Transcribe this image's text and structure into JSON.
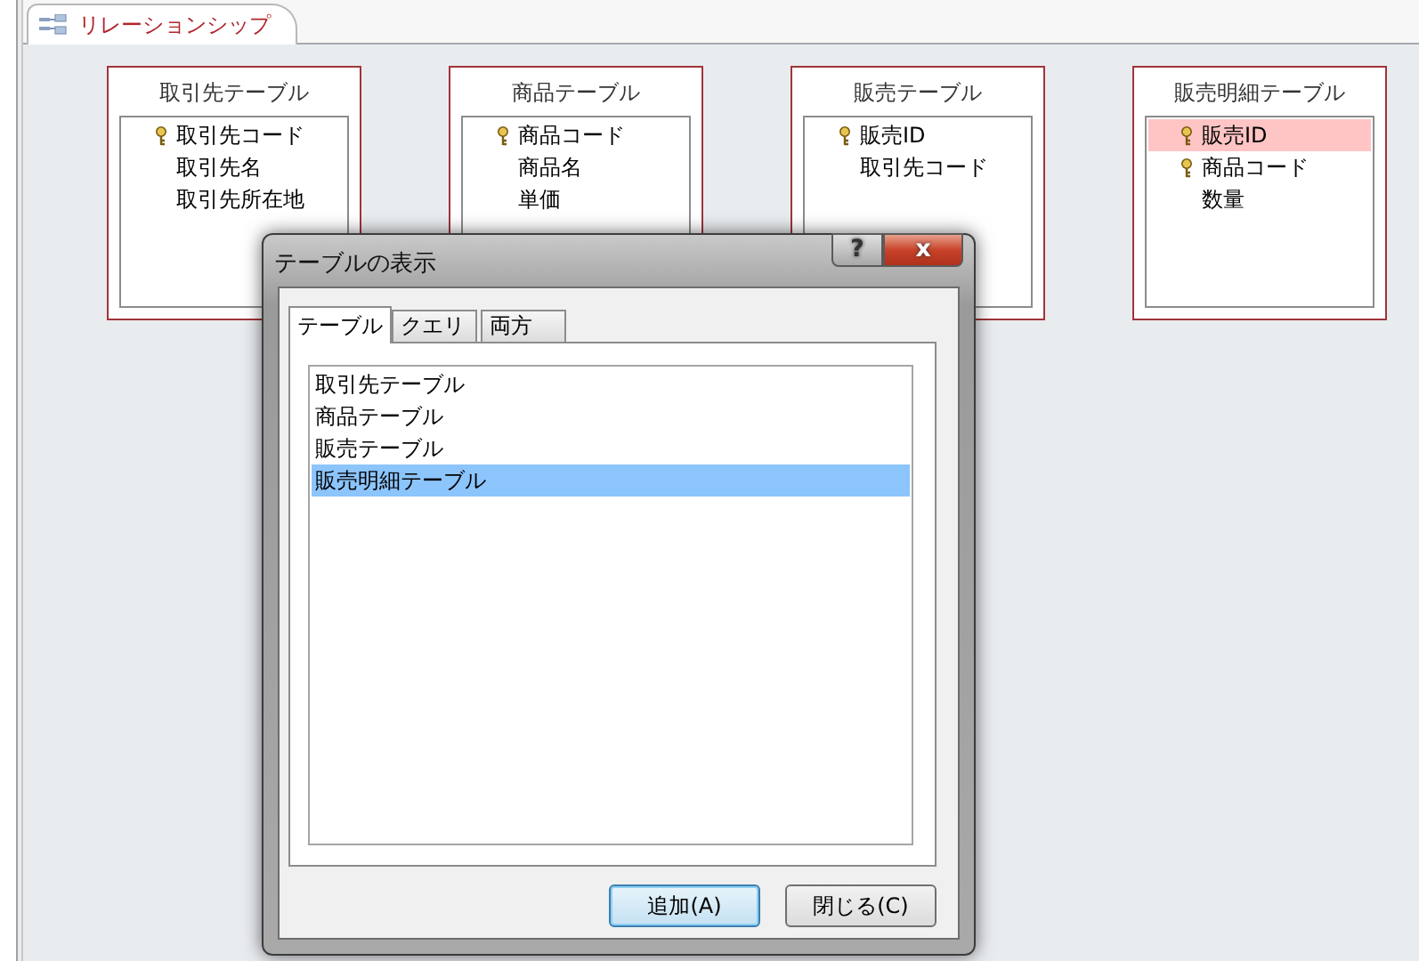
{
  "document_tab": {
    "label": "リレーションシップ",
    "selected": true
  },
  "tables": [
    {
      "title": "取引先テーブル",
      "fields": [
        {
          "name": "取引先コード",
          "key": true,
          "selected": false
        },
        {
          "name": "取引先名",
          "key": false,
          "selected": false
        },
        {
          "name": "取引先所在地",
          "key": false,
          "selected": false
        }
      ]
    },
    {
      "title": "商品テーブル",
      "fields": [
        {
          "name": "商品コード",
          "key": true,
          "selected": false
        },
        {
          "name": "商品名",
          "key": false,
          "selected": false
        },
        {
          "name": "単価",
          "key": false,
          "selected": false
        }
      ]
    },
    {
      "title": "販売テーブル",
      "fields": [
        {
          "name": "販売ID",
          "key": true,
          "selected": false
        },
        {
          "name": "取引先コード",
          "key": false,
          "selected": false
        }
      ]
    },
    {
      "title": "販売明細テーブル",
      "fields": [
        {
          "name": "販売ID",
          "key": true,
          "selected": true
        },
        {
          "name": "商品コード",
          "key": true,
          "selected": false
        },
        {
          "name": "数量",
          "key": false,
          "selected": false
        }
      ]
    }
  ],
  "dialog": {
    "title": "テーブルの表示",
    "help_button": "?",
    "close_button": "x",
    "tabs": [
      {
        "label": "テーブル",
        "selected": true
      },
      {
        "label": "クエリ",
        "selected": false
      },
      {
        "label": "両方",
        "selected": false
      }
    ],
    "items": [
      {
        "label": "取引先テーブル",
        "selected": false
      },
      {
        "label": "商品テーブル",
        "selected": false
      },
      {
        "label": "販売テーブル",
        "selected": false
      },
      {
        "label": "販売明細テーブル",
        "selected": true
      }
    ],
    "buttons": [
      {
        "label": "追加(A)",
        "default": true
      },
      {
        "label": "閉じる(C)",
        "default": false
      }
    ]
  }
}
